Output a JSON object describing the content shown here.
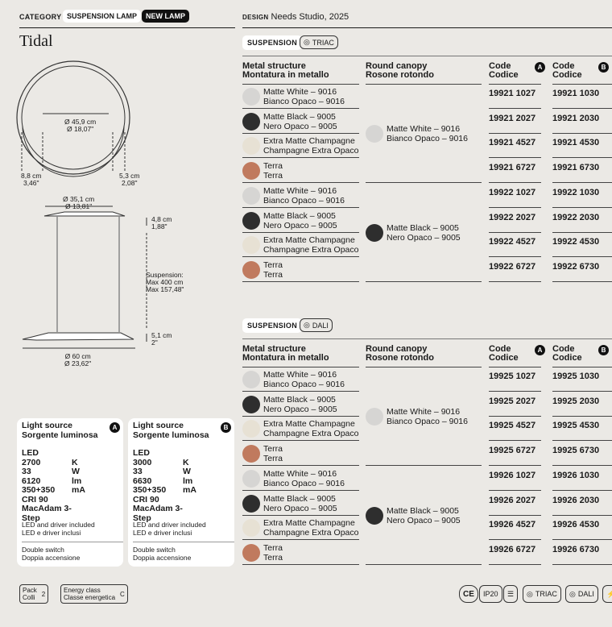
{
  "header": {
    "category_label": "CATEGORY",
    "category_value": "SUSPENSION LAMP",
    "new_badge": "NEW LAMP",
    "design_label": "DESIGN",
    "design_value": "Needs Studio, 2025"
  },
  "product": {
    "name": "Tidal"
  },
  "drawing": {
    "ring_diameter": "Ø 45,9 cm",
    "ring_diameter_in": "Ø 18,07\"",
    "ring_left_depth": "8,8 cm",
    "ring_left_depth_in": "3,46\"",
    "ring_right_depth": "5,3 cm",
    "ring_right_depth_in": "2,08\"",
    "canopy_diameter": "Ø 35,1 cm",
    "canopy_diameter_in": "Ø 13,81\"",
    "canopy_height": "4,8 cm",
    "canopy_height_in": "1,88\"",
    "suspension_1": "Suspension:",
    "suspension_2": "Max 400 cm",
    "suspension_3": "Max 157,48\"",
    "disc_height": "5,1 cm",
    "disc_height_in": "2\"",
    "disc_diameter": "Ø 60 cm",
    "disc_diameter_in": "Ø 23,62\""
  },
  "columns": {
    "metal_1": "Metal structure",
    "metal_2": "Montatura in metallo",
    "canopy_1": "Round canopy",
    "canopy_2": "Rosone rotondo",
    "code_1": "Code",
    "code_2": "Codice",
    "badge_a": "A",
    "badge_b": "B"
  },
  "sections": [
    {
      "label": "SUSPENSION",
      "tag": "TRIAC",
      "finishes": [
        {
          "l1": "Matte White – 9016",
          "l2": "Bianco Opaco – 9016",
          "color": "#d6d5d3",
          "a": "19921 1027",
          "b": "19921 1030"
        },
        {
          "l1": "Matte Black – 9005",
          "l2": "Nero Opaco – 9005",
          "color": "#2e2e2e",
          "a": "19921 2027",
          "b": "19921 2030"
        },
        {
          "l1": "Extra Matte Champagne",
          "l2": "Champagne Extra Opaco",
          "color": "#e7e1d4",
          "a": "19921 4527",
          "b": "19921 4530"
        },
        {
          "l1": "Terra",
          "l2": "Terra",
          "color": "#c07a5e",
          "a": "19921 6727",
          "b": "19921 6730"
        },
        {
          "l1": "Matte White – 9016",
          "l2": "Bianco Opaco – 9016",
          "color": "#d6d5d3",
          "a": "19922 1027",
          "b": "19922 1030"
        },
        {
          "l1": "Matte Black – 9005",
          "l2": "Nero Opaco – 9005",
          "color": "#2e2e2e",
          "a": "19922 2027",
          "b": "19922 2030"
        },
        {
          "l1": "Extra Matte Champagne",
          "l2": "Champagne Extra Opaco",
          "color": "#e7e1d4",
          "a": "19922 4527",
          "b": "19922 4530"
        },
        {
          "l1": "Terra",
          "l2": "Terra",
          "color": "#c07a5e",
          "a": "19922 6727",
          "b": "19922 6730"
        }
      ],
      "canopies": [
        {
          "l1": "Matte White – 9016",
          "l2": "Bianco Opaco – 9016",
          "color": "#d6d5d3"
        },
        {
          "l1": "Matte Black – 9005",
          "l2": "Nero Opaco – 9005",
          "color": "#2e2e2e"
        }
      ]
    },
    {
      "label": "SUSPENSION",
      "tag": "DALI",
      "finishes": [
        {
          "l1": "Matte White – 9016",
          "l2": "Bianco Opaco – 9016",
          "color": "#d6d5d3",
          "a": "19925 1027",
          "b": "19925 1030"
        },
        {
          "l1": "Matte Black – 9005",
          "l2": "Nero Opaco – 9005",
          "color": "#2e2e2e",
          "a": "19925 2027",
          "b": "19925 2030"
        },
        {
          "l1": "Extra Matte Champagne",
          "l2": "Champagne Extra Opaco",
          "color": "#e7e1d4",
          "a": "19925 4527",
          "b": "19925 4530"
        },
        {
          "l1": "Terra",
          "l2": "Terra",
          "color": "#c07a5e",
          "a": "19925 6727",
          "b": "19925 6730"
        },
        {
          "l1": "Matte White – 9016",
          "l2": "Bianco Opaco – 9016",
          "color": "#d6d5d3",
          "a": "19926 1027",
          "b": "19926 1030"
        },
        {
          "l1": "Matte Black – 9005",
          "l2": "Nero Opaco – 9005",
          "color": "#2e2e2e",
          "a": "19926 2027",
          "b": "19926 2030"
        },
        {
          "l1": "Extra Matte Champagne",
          "l2": "Champagne Extra Opaco",
          "color": "#e7e1d4",
          "a": "19926 4527",
          "b": "19926 4530"
        },
        {
          "l1": "Terra",
          "l2": "Terra",
          "color": "#c07a5e",
          "a": "19926 6727",
          "b": "19926 6730"
        }
      ],
      "canopies": [
        {
          "l1": "Matte White – 9016",
          "l2": "Bianco Opaco – 9016",
          "color": "#d6d5d3"
        },
        {
          "l1": "Matte Black – 9005",
          "l2": "Nero Opaco – 9005",
          "color": "#2e2e2e"
        }
      ]
    }
  ],
  "light_cards": [
    {
      "title_1": "Light source",
      "title_2": "Sorgente luminosa",
      "badge": "A",
      "specs": [
        [
          "LED",
          ""
        ],
        [
          "2700",
          "K"
        ],
        [
          "33",
          "W"
        ],
        [
          "6120",
          "lm"
        ],
        [
          "350+350",
          "mA"
        ],
        [
          "CRI 90",
          ""
        ],
        [
          "MacAdam 3-Step",
          ""
        ]
      ],
      "note_1": "LED and driver included",
      "note_2": "LED e driver inclusi",
      "switch_1": "Double switch",
      "switch_2": "Doppia accensione"
    },
    {
      "title_1": "Light source",
      "title_2": "Sorgente luminosa",
      "badge": "B",
      "specs": [
        [
          "LED",
          ""
        ],
        [
          "3000",
          "K"
        ],
        [
          "33",
          "W"
        ],
        [
          "6630",
          "lm"
        ],
        [
          "350+350",
          "mA"
        ],
        [
          "CRI 90",
          ""
        ],
        [
          "MacAdam 3-Step",
          ""
        ]
      ],
      "note_1": "LED and driver included",
      "note_2": "LED e driver inclusi",
      "switch_1": "Double switch",
      "switch_2": "Doppia accensione"
    }
  ],
  "footer": {
    "pack_1": "Pack",
    "pack_2": "Colli",
    "pack_value": "2",
    "energy_1": "Energy class",
    "energy_2": "Classe energetica",
    "energy_value": "C",
    "icons": [
      "CE",
      "IP20",
      "TRIAC",
      "DALI"
    ]
  }
}
